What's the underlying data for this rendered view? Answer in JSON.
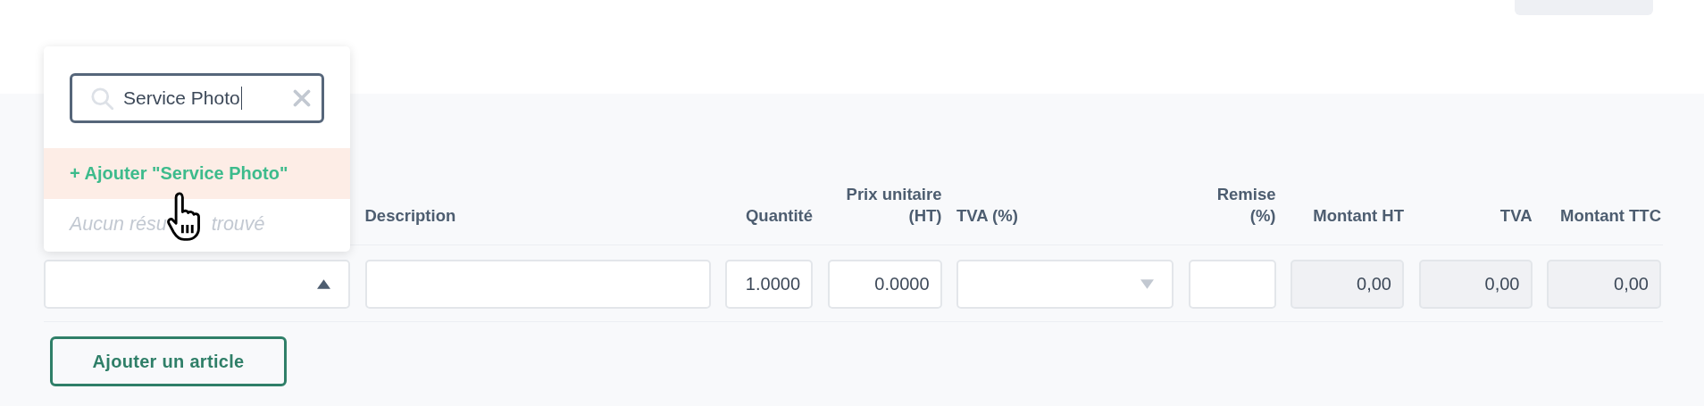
{
  "columns": [
    "Description",
    "Quantité",
    "Prix unitaire (HT)",
    "TVA (%)",
    "Remise (%)",
    "Montant HT",
    "TVA",
    "Montant TTC"
  ],
  "row": [
    {
      "kind": "select",
      "expanded": true
    },
    {
      "kind": "text"
    },
    {
      "kind": "number",
      "value": "1.0000"
    },
    {
      "kind": "number",
      "value": "0.0000"
    },
    {
      "kind": "select",
      "expanded": false
    },
    {
      "kind": "number"
    },
    {
      "kind": "readonly",
      "value": "0,00"
    },
    {
      "kind": "readonly",
      "value": "0,00"
    },
    {
      "kind": "readonly",
      "value": "0,00"
    }
  ],
  "dropdown": {
    "search": {
      "value": "Service Photo"
    },
    "options": [
      {
        "kind": "add",
        "label": "+ Ajouter \"Service Photo\"",
        "selected": true
      },
      {
        "kind": "empty",
        "label_parts": [
          "Aucun résu",
          "trouvé"
        ],
        "selected": false
      }
    ]
  },
  "add_button": {
    "label": "Ajouter un article"
  }
}
